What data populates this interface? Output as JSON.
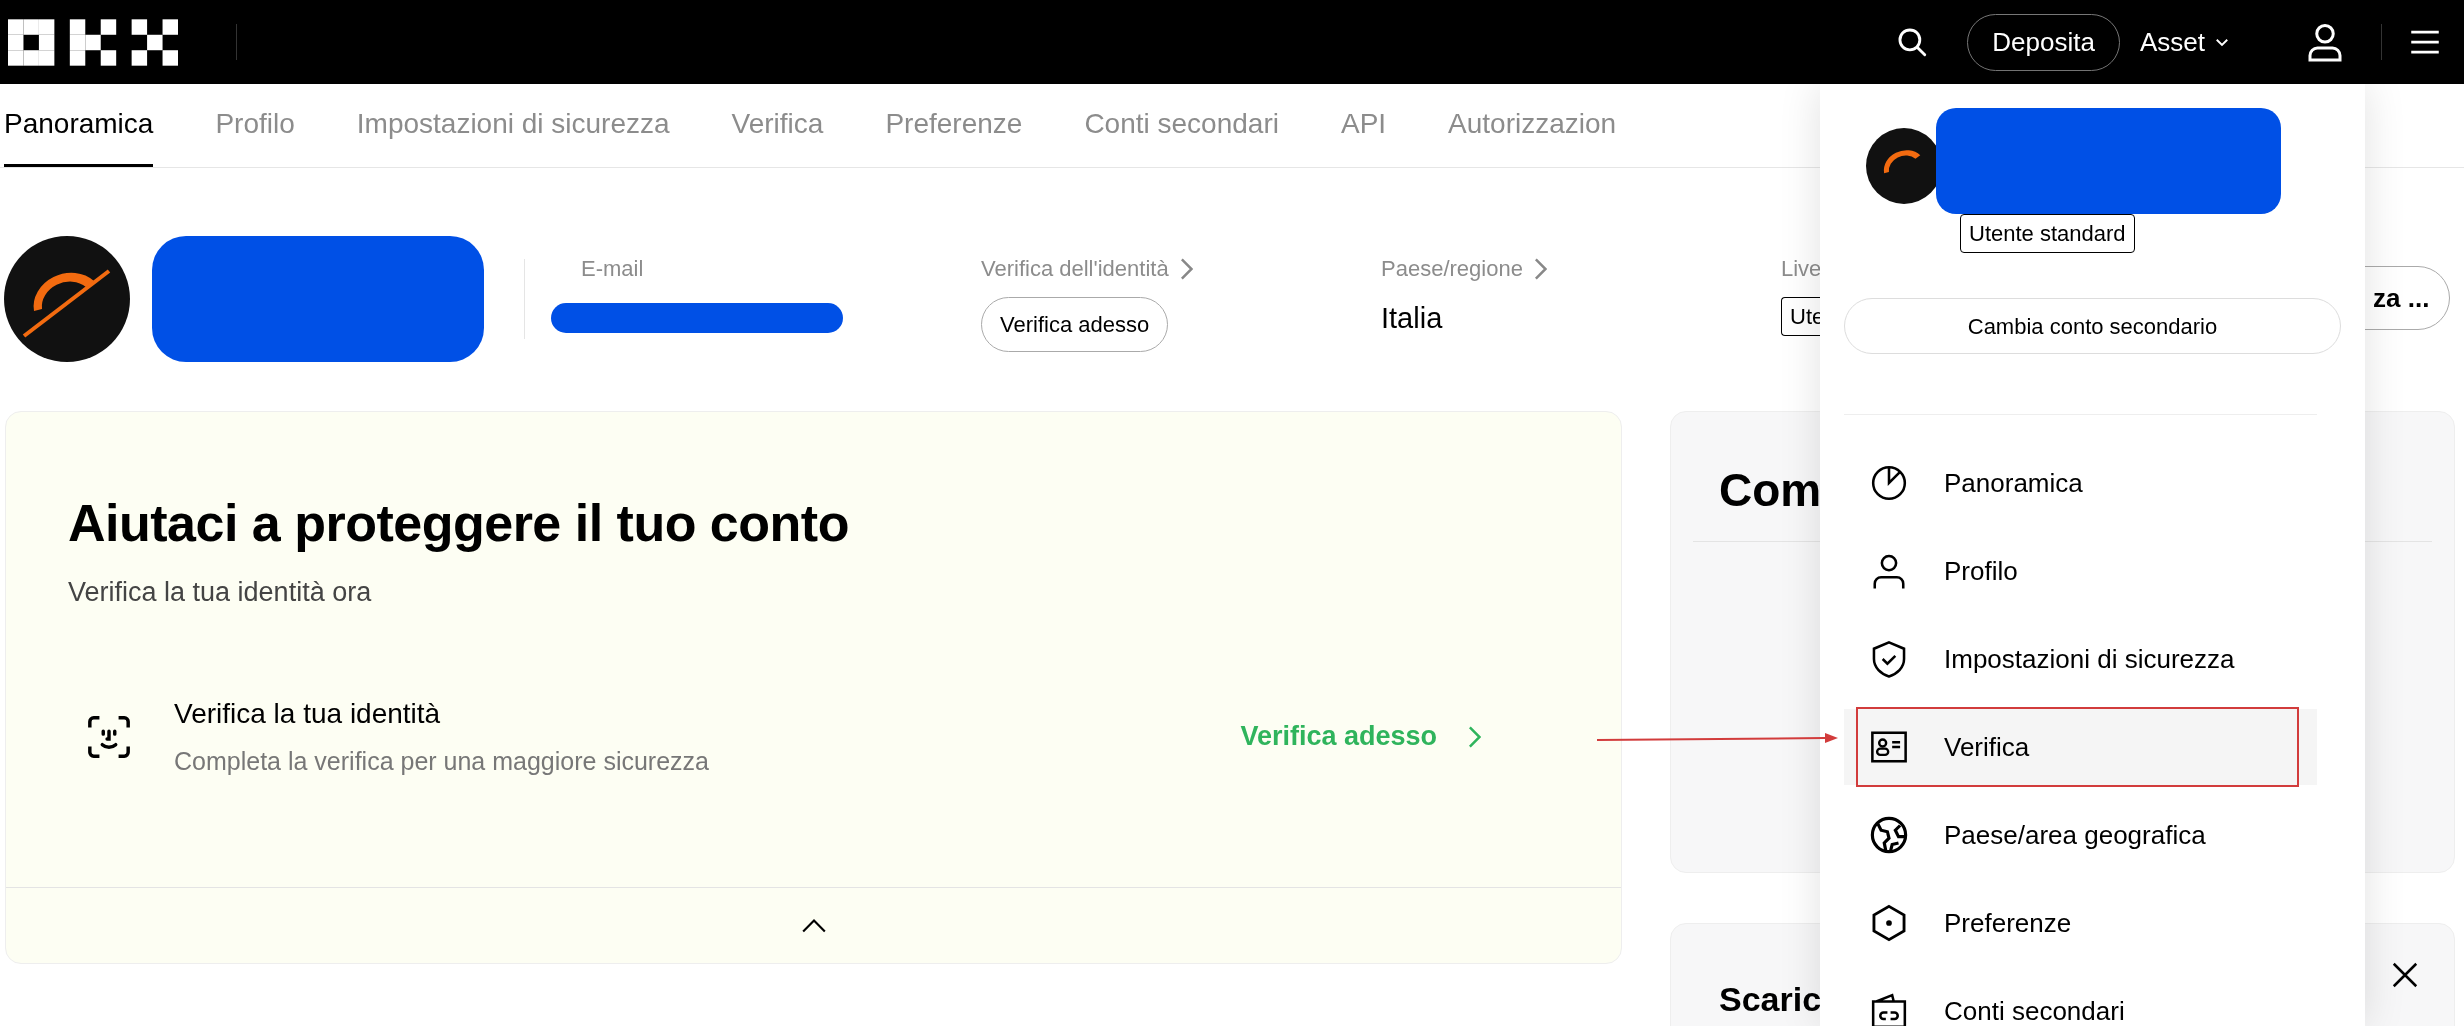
{
  "topbar": {
    "deposit_button": "Deposita",
    "asset_menu": "Asset"
  },
  "tabs": [
    {
      "label": "Panoramica",
      "selected": true
    },
    {
      "label": "Profilo",
      "selected": false
    },
    {
      "label": "Impostazioni di sicurezza",
      "selected": false
    },
    {
      "label": "Verifica",
      "selected": false
    },
    {
      "label": "Preferenze",
      "selected": false
    },
    {
      "label": "Conti secondari",
      "selected": false
    },
    {
      "label": "API",
      "selected": false
    },
    {
      "label": "Autorizzazion",
      "selected": false
    }
  ],
  "profile": {
    "email_label": "E-mail",
    "identity_label": "Verifica dell'identità",
    "identity_button": "Verifica adesso",
    "country_label": "Paese/regione",
    "country_value": "Italia",
    "level_label": "Live",
    "level_badge": "Ute",
    "action_button": "za ..."
  },
  "security_card": {
    "title": "Aiutaci a proteggere il tuo conto",
    "subtitle": "Verifica la tua identità ora",
    "task": {
      "title": "Verifica la tua identità",
      "description": "Completa la verifica per una maggiore sicurezza",
      "link": "Verifica adesso"
    }
  },
  "side_cards": [
    {
      "title": "Com"
    },
    {
      "title": "Scaric"
    }
  ],
  "account_menu": {
    "badge": "Utente standard",
    "switch_button": "Cambia conto secondario",
    "items": [
      {
        "label": "Panoramica",
        "selected": false
      },
      {
        "label": "Profilo",
        "selected": false
      },
      {
        "label": "Impostazioni di sicurezza",
        "selected": false
      },
      {
        "label": "Verifica",
        "selected": true
      },
      {
        "label": "Paese/area geografica",
        "selected": false
      },
      {
        "label": "Preferenze",
        "selected": false
      },
      {
        "label": "Conti secondari",
        "selected": false
      }
    ]
  }
}
